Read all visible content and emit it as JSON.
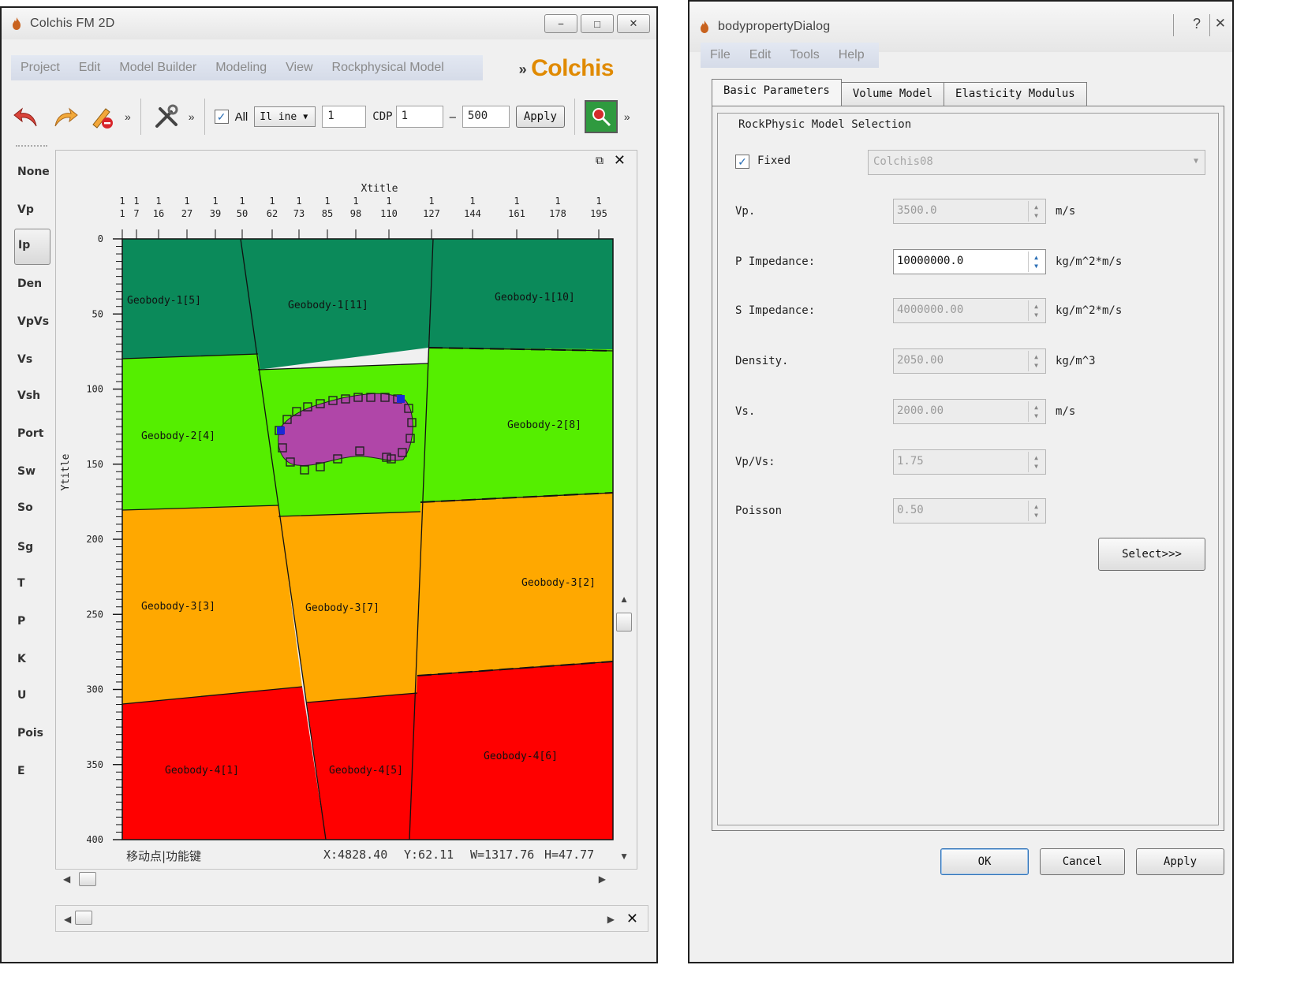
{
  "left_window": {
    "title": "Colchis FM 2D",
    "menu": [
      "Project",
      "Edit",
      "Model Builder",
      "Modeling",
      "View",
      "Rockphysical Model"
    ],
    "brand": "Colchis",
    "toolbar": {
      "all_label": "All",
      "line_select": "Il ine",
      "line_value": "1",
      "cdp_label": "CDP",
      "cdp_from": "1",
      "cdp_to": "500",
      "apply_label": "Apply"
    },
    "side_props": [
      "None",
      "Vp",
      "Ip",
      "Den",
      "VpVs",
      "Vs",
      "Vsh",
      "Port",
      "Sw",
      "So",
      "Sg",
      "T",
      "P",
      "K",
      "U",
      "Pois",
      "E"
    ],
    "side_active": "Ip",
    "plot": {
      "xtitle": "Xtitle",
      "ytitle": "Ytitle",
      "xticks": [
        {
          "top": "1",
          "bottom": "1"
        },
        {
          "top": "1",
          "bottom": "7"
        },
        {
          "top": "1",
          "bottom": "16"
        },
        {
          "top": "1",
          "bottom": "27"
        },
        {
          "top": "1",
          "bottom": "39"
        },
        {
          "top": "1",
          "bottom": "50"
        },
        {
          "top": "1",
          "bottom": "62"
        },
        {
          "top": "1",
          "bottom": "73"
        },
        {
          "top": "1",
          "bottom": "85"
        },
        {
          "top": "1",
          "bottom": "98"
        },
        {
          "top": "1",
          "bottom": "110"
        },
        {
          "top": "1",
          "bottom": "127"
        },
        {
          "top": "1",
          "bottom": "144"
        },
        {
          "top": "1",
          "bottom": "161"
        },
        {
          "top": "1",
          "bottom": "178"
        },
        {
          "top": "1",
          "bottom": "195"
        }
      ],
      "yticks": [
        "0",
        "50",
        "100",
        "150",
        "200",
        "250",
        "300",
        "350",
        "400"
      ],
      "bodies": [
        {
          "label": "Geobody-1[5]"
        },
        {
          "label": "Geobody-1[11]"
        },
        {
          "label": "Geobody-1[10]"
        },
        {
          "label": "Geobody-2[4]"
        },
        {
          "label": "Geobody-2[8]"
        },
        {
          "label": "Geobody-3[3]"
        },
        {
          "label": "Geobody-3[7]"
        },
        {
          "label": "Geobody-3[2]"
        },
        {
          "label": "Geobody-4[1]"
        },
        {
          "label": "Geobody-4[5]"
        },
        {
          "label": "Geobody-4[6]"
        }
      ],
      "colors": {
        "layer1": "#0b8a5a",
        "layer2": "#55ee00",
        "layer3": "#ffa800",
        "layer4": "#ff0000",
        "lens": "#b046a8"
      }
    },
    "status": {
      "hint": "移动点|功能键",
      "x": "X:4828.40",
      "y": "Y:62.11",
      "w": "W=1317.76",
      "h": "H=47.77"
    }
  },
  "dialog": {
    "title": "bodypropertyDialog",
    "menu": [
      "File",
      "Edit",
      "Tools",
      "Help"
    ],
    "tabs": [
      "Basic Parameters",
      "Volume Model",
      "Elasticity Modulus"
    ],
    "group_title": "RockPhysic Model Selection",
    "fixed_label": "Fixed",
    "model_value": "Colchis08",
    "fields": [
      {
        "label": "Vp.",
        "value": "3500.0",
        "unit": "m/s"
      },
      {
        "label": "P Impedance:",
        "value": "10000000.0",
        "unit": "kg/m^2*m/s"
      },
      {
        "label": "S Impedance:",
        "value": "4000000.00",
        "unit": "kg/m^2*m/s"
      },
      {
        "label": "Density.",
        "value": "2050.00",
        "unit": "kg/m^3"
      },
      {
        "label": "Vs.",
        "value": "2000.00",
        "unit": "m/s"
      },
      {
        "label": "Vp/Vs:",
        "value": "1.75",
        "unit": ""
      },
      {
        "label": "Poisson",
        "value": "0.50",
        "unit": ""
      }
    ],
    "select_label": "Select>>>",
    "ok_label": "OK",
    "cancel_label": "Cancel",
    "apply_label": "Apply"
  }
}
